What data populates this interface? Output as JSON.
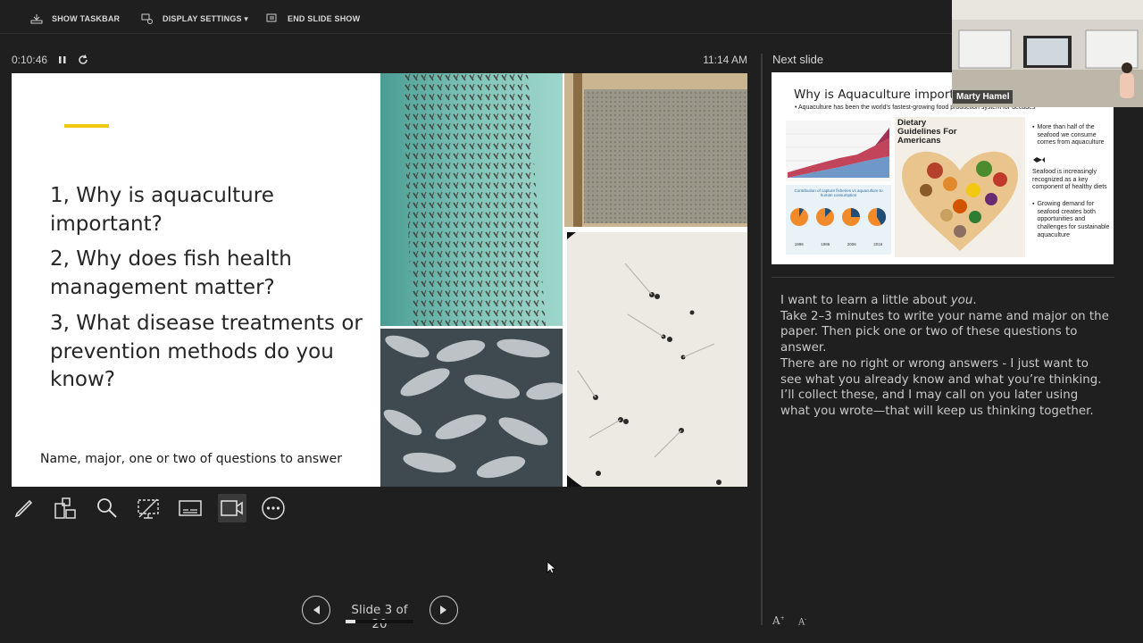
{
  "toolbar": {
    "show_taskbar": "SHOW TASKBAR",
    "display_settings": "DISPLAY SETTINGS ▾",
    "end_slide_show": "END SLIDE SHOW"
  },
  "timer": {
    "elapsed": "0:10:46",
    "clock": "11:14 AM"
  },
  "current_slide": {
    "questions": [
      "1, Why is aquaculture important?",
      "2, Why does fish health management matter?",
      "3, What disease treatments or prevention methods do you know?"
    ],
    "footnote": "Name, major, one or two of questions to answer",
    "accent_color": "#f2c811"
  },
  "next_slide": {
    "label": "Next slide",
    "title": "Why is Aquaculture importa",
    "subtitle": "Aquaculture has been the world's fastest-growing food production system for decades",
    "poster_title": "Dietary Guidelines For Americans",
    "bullets": [
      "More than half of the seafood we consume comes from aquaculture",
      "Seafood is increasingly recognized as a key component of healthy diets",
      "Growing demand for seafood creates both opportunities and challenges for sustainable aquaculture"
    ],
    "chart_caption": "Contribution of capture fisheries vs aquaculture to human consumption",
    "pie_years": [
      "1996",
      "1986",
      "2006",
      "2016"
    ]
  },
  "video": {
    "presenter_name": "Marty Hamel"
  },
  "notes": {
    "line1_prefix": "I want to learn a little about ",
    "line1_emph": "you",
    "line1_suffix": ".",
    "line2": "Take 2–3 minutes to write your name and major on the paper. Then pick one or two of these questions to answer.",
    "line3": "There are no right or wrong answers - I just want to see what you already know and what you’re thinking. I’ll collect these, and I may call on you later using what you wrote—that will keep us thinking together."
  },
  "navigation": {
    "slide_counter": "Slide 3 of 20",
    "current": 3,
    "total": 20,
    "progress_fraction": 0.15
  },
  "font_controls": {
    "increase": "A",
    "decrease": "A"
  }
}
